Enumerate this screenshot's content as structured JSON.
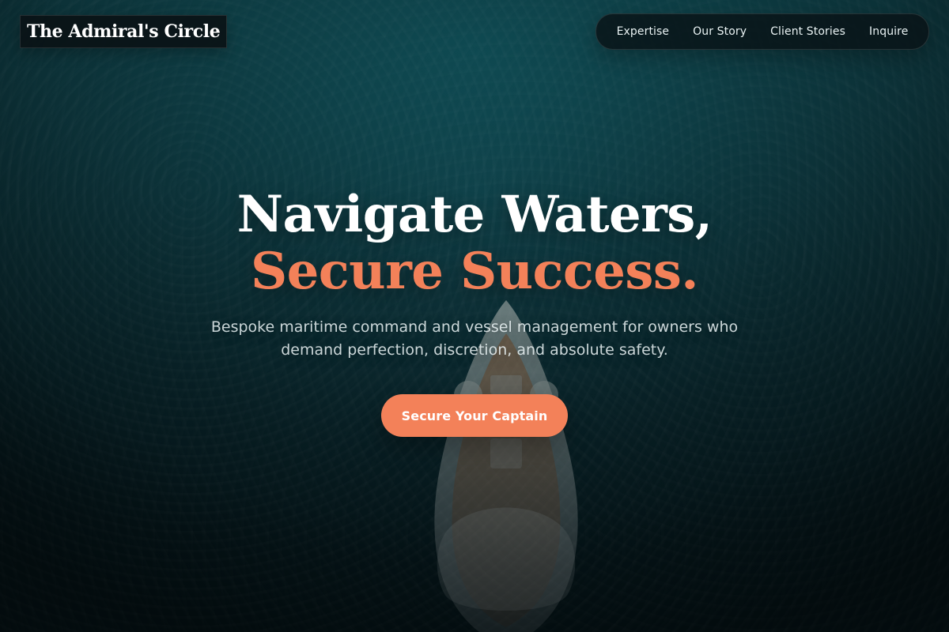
{
  "header": {
    "brand": "The Admiral's Circle",
    "nav": [
      {
        "label": "Expertise"
      },
      {
        "label": "Our Story"
      },
      {
        "label": "Client Stories"
      },
      {
        "label": "Inquire"
      }
    ]
  },
  "hero": {
    "headline_line1": "Navigate Waters,",
    "headline_line2": "Secure Success.",
    "subheadline": "Bespoke maritime command and vessel management for owners who demand perfection, discretion, and absolute safety.",
    "cta_label": "Secure Your Captain"
  },
  "theme": {
    "accent": "#f38159",
    "dark_overlay": "#0b2b31"
  },
  "icons": {
    "boat": "boat-icon"
  }
}
